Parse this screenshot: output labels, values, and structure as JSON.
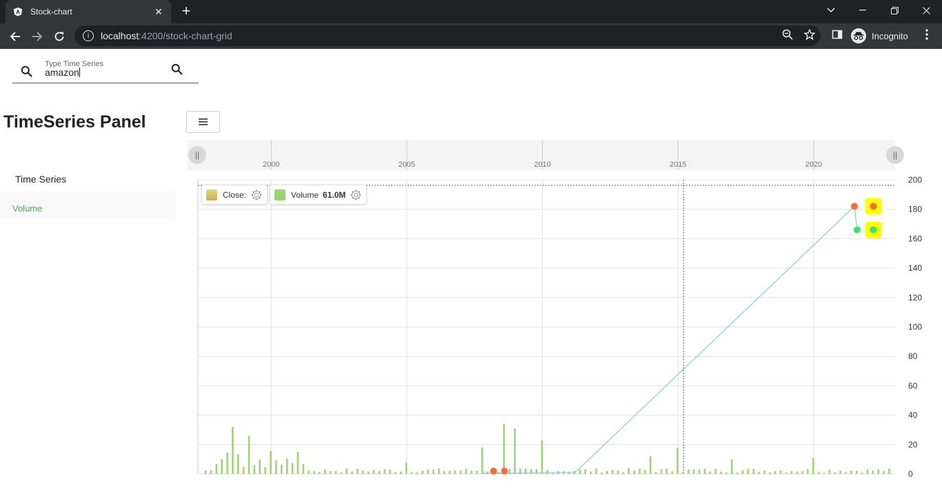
{
  "browser": {
    "tab_title": "Stock-chart",
    "url_host": "localhost",
    "url_path": ":4200/stock-chart-grid",
    "profile_label": "Incognito"
  },
  "search": {
    "label": "Type Time Series",
    "value": "amazon"
  },
  "sidebar": {
    "title": "TimeSeries Panel",
    "section_label": "Time Series",
    "items": [
      {
        "label": "Volume"
      }
    ]
  },
  "legend": {
    "close_label": "Close:",
    "volume_label": "Volume",
    "volume_value": "61.0M"
  },
  "colors": {
    "accent_green": "#4caf50",
    "volume_bar": "#9bd36e",
    "line": "#87ceeb",
    "point_orange": "#ff6a2f",
    "point_green": "#2ee86b",
    "highlight": "#ffff00"
  },
  "chart_data": {
    "type": "line",
    "navigator_ticks": [
      "2000",
      "2005",
      "2010",
      "2015",
      "2020"
    ],
    "y_ticks": [
      "200",
      "180",
      "160",
      "140",
      "120",
      "100",
      "80",
      "60",
      "40",
      "20",
      "0"
    ],
    "ylim": [
      0,
      200
    ],
    "xlim": [
      1997.3,
      2023.0
    ],
    "crosshair_x": 2015.2,
    "grid": true,
    "legend_position": "top-left",
    "series": [
      {
        "name": "Close",
        "x": [
          2007.8,
          2011.2,
          2021.5,
          2021.6
        ],
        "y": [
          0.5,
          1,
          182,
          166
        ]
      },
      {
        "name": "Volume"
      }
    ],
    "markers": [
      {
        "x": 2008.2,
        "y": 2,
        "color": "orange"
      },
      {
        "x": 2008.6,
        "y": 2,
        "color": "orange"
      },
      {
        "x": 2021.5,
        "y": 182,
        "color": "orange"
      },
      {
        "x": 2021.6,
        "y": 166,
        "color": "green"
      },
      {
        "x": 2022.2,
        "y": 182,
        "color": "orange",
        "highlighted": true
      },
      {
        "x": 2022.2,
        "y": 166,
        "color": "green",
        "highlighted": true
      }
    ],
    "volume_spikes": [
      {
        "x": 1998.6,
        "v": 32
      },
      {
        "x": 1999.2,
        "v": 26
      },
      {
        "x": 2001.0,
        "v": 15
      },
      {
        "x": 2005.0,
        "v": 8
      },
      {
        "x": 2007.7,
        "v": 18
      },
      {
        "x": 2008.5,
        "v": 34
      },
      {
        "x": 2009.0,
        "v": 31
      },
      {
        "x": 2010.0,
        "v": 23
      },
      {
        "x": 2014.0,
        "v": 12
      },
      {
        "x": 2015.0,
        "v": 18
      },
      {
        "x": 2017.0,
        "v": 10
      },
      {
        "x": 2020.0,
        "v": 11
      }
    ]
  }
}
